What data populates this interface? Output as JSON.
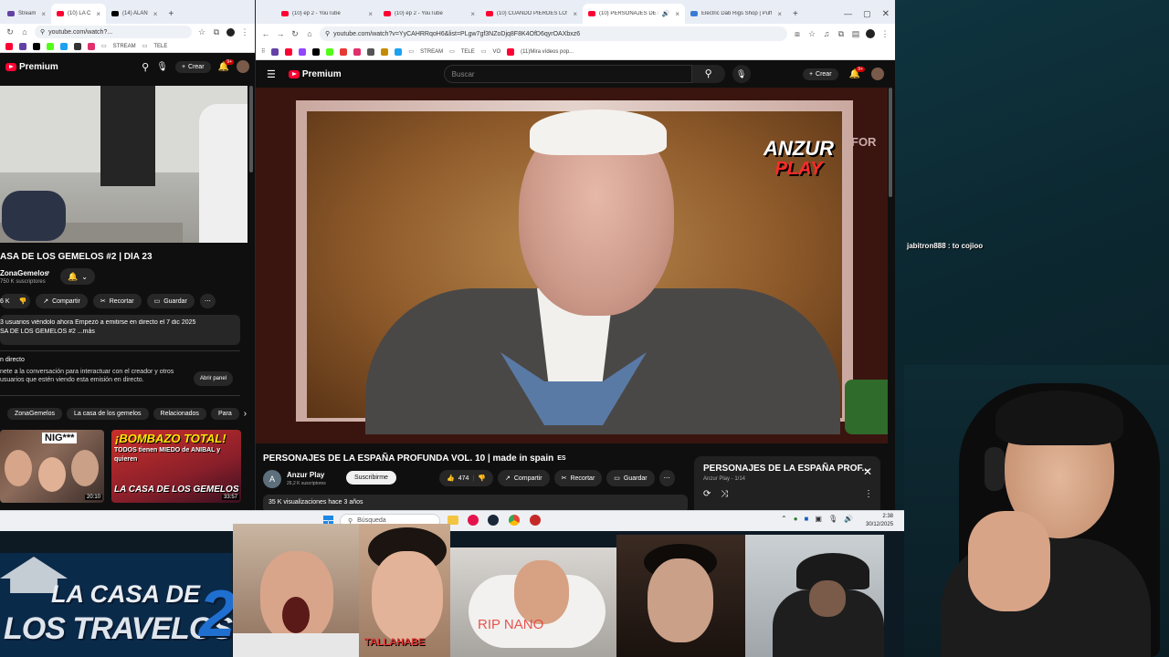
{
  "left_window": {
    "tabs": [
      {
        "label": "Stream"
      },
      {
        "label": "(10) LA C"
      },
      {
        "label": "(14) ALAN"
      }
    ],
    "url": "youtube.com/watch?...",
    "bookmarks": [
      "STREAM",
      "TELE"
    ],
    "header": {
      "logo": "Premium",
      "create": "Crear",
      "notif_count": "9+"
    },
    "video": {
      "title": "ASA DE LOS GEMELOS #2 | DÍA 23",
      "channel": "ZonaGemelos",
      "subs": "750 K suscriptores",
      "likes": "6 K",
      "share": "Compartir",
      "clip": "Recortar",
      "save": "Guardar"
    },
    "description": {
      "line1": "3 usuarios viéndolo ahora  Empezó a emitirse en directo el 7 dic 2025",
      "line2": "SA DE LOS GEMELOS #2 ...más"
    },
    "live_chat": {
      "title": "n directo",
      "text1": "nete a la conversación para interactuar con el creador y otros",
      "text2": "usuarios que estén viendo esta emisión en directo.",
      "button": "Abrir panel"
    },
    "chips": [
      "ZonaGemelos",
      "La casa de los gemelos",
      "Relacionados",
      "Para"
    ],
    "thumbs": [
      {
        "overlay": "NIG***",
        "duration": "20:10"
      },
      {
        "overlay": "¡BOMBAZO TOTAL!",
        "text2": "TODOS tienen MIEDO de ANIBAL y quieren",
        "text3": "LA CASA DE LOS GEMELOS",
        "duration": "33:57"
      }
    ]
  },
  "right_window": {
    "tabs": [
      {
        "label": "(10) ep 2 - YouTube"
      },
      {
        "label": "(10) ep 2 - YouTube"
      },
      {
        "label": "(10) CUANDO PIERDES LOS"
      },
      {
        "label": "(10) PERSONAJES DE LA"
      },
      {
        "label": "Electric Dab Rigs Shop | Puff"
      }
    ],
    "url": "youtube.com/watch?v=YyCAHRRqoH6&list=PLgw7gf3NZoDjq8F8K4OfD6qyrOAXbxz6",
    "bookmarks": [
      "STREAM",
      "TELE",
      "VO",
      "(11)Mira vídeos pop..."
    ],
    "header": {
      "logo": "Premium",
      "search_placeholder": "Buscar",
      "create": "Crear",
      "notif_count": "9+"
    },
    "player": {
      "watermark_line1": "ANZUR",
      "watermark_line2": "PLAY",
      "corner_text": "FOR"
    },
    "video": {
      "title": "PERSONAJES DE LA ESPAÑA PROFUNDA VOL. 10 | made in spain",
      "lang_badge": "ES",
      "channel": "Anzur Play",
      "channel_initial": "A",
      "subs": "26,2 K suscriptores",
      "subscribe": "Suscribirme",
      "likes": "474",
      "share": "Compartir",
      "clip": "Recortar",
      "save": "Guardar",
      "views": "35 K visualizaciones  hace 3 años"
    },
    "playlist": {
      "title": "PERSONAJES DE LA ESPAÑA PROF...",
      "meta": "Anzur Play - 1/14"
    }
  },
  "taskbar": {
    "search": "Búsqueda",
    "time": "2:38",
    "date": "30/12/2025"
  },
  "overlay": {
    "chat": {
      "user": "jabitron888",
      "message": " : to cojioo"
    },
    "logo_line1": "LA CASA DE",
    "logo_line2": "LOS TRAVELOS",
    "logo_number": "2",
    "cam_labels": {
      "cam2": "TALLAHABE",
      "cam3": "RIP NANO"
    }
  },
  "colors": {
    "yt_red": "#ff0033",
    "yt_bg": "#0f0f0f",
    "pill": "#272727"
  }
}
